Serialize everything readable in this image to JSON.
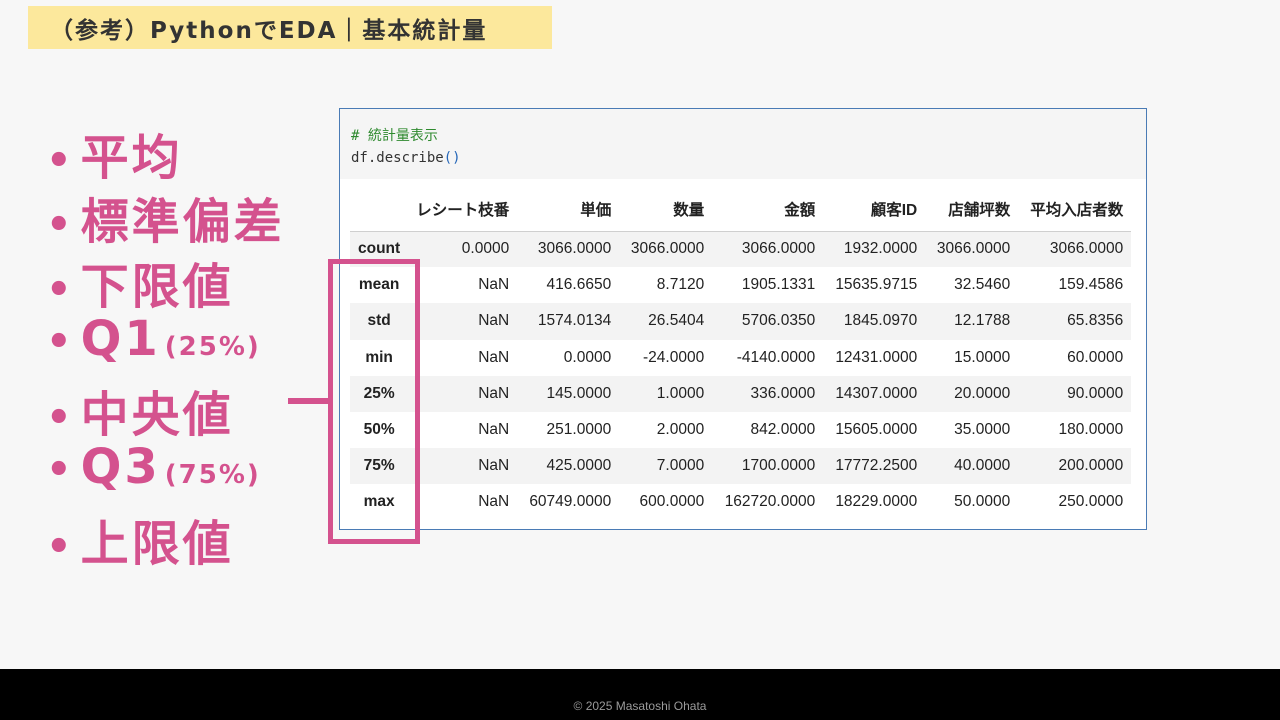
{
  "title": "（参考）PythonでEDA｜基本統計量",
  "bullets": [
    {
      "bullet": "•",
      "text": "平均",
      "sub": ""
    },
    {
      "bullet": "•",
      "text": "標準偏差",
      "sub": ""
    },
    {
      "bullet": "•",
      "text": "下限値",
      "sub": ""
    },
    {
      "bullet": "•",
      "text": "Q1",
      "sub": "(25%)"
    },
    {
      "bullet": "•",
      "text": "中央値",
      "sub": ""
    },
    {
      "bullet": "•",
      "text": "Q3",
      "sub": "(75%)"
    },
    {
      "bullet": "•",
      "text": "上限値",
      "sub": ""
    }
  ],
  "code": {
    "comment": "# 統計量表示",
    "line_prefix": "df.describe",
    "line_parens": "()"
  },
  "table": {
    "headers": [
      "",
      "レシート枝番",
      "単価",
      "数量",
      "金額",
      "顧客ID",
      "店舗坪数",
      "平均入店者数"
    ],
    "rows": [
      {
        "label": "count",
        "cells": [
          "0.0000",
          "3066.0000",
          "3066.0000",
          "3066.0000",
          "1932.0000",
          "3066.0000",
          "3066.0000"
        ]
      },
      {
        "label": "mean",
        "cells": [
          "NaN",
          "416.6650",
          "8.7120",
          "1905.1331",
          "15635.9715",
          "32.5460",
          "159.4586"
        ]
      },
      {
        "label": "std",
        "cells": [
          "NaN",
          "1574.0134",
          "26.5404",
          "5706.0350",
          "1845.0970",
          "12.1788",
          "65.8356"
        ]
      },
      {
        "label": "min",
        "cells": [
          "NaN",
          "0.0000",
          "-24.0000",
          "-4140.0000",
          "12431.0000",
          "15.0000",
          "60.0000"
        ]
      },
      {
        "label": "25%",
        "cells": [
          "NaN",
          "145.0000",
          "1.0000",
          "336.0000",
          "14307.0000",
          "20.0000",
          "90.0000"
        ]
      },
      {
        "label": "50%",
        "cells": [
          "NaN",
          "251.0000",
          "2.0000",
          "842.0000",
          "15605.0000",
          "35.0000",
          "180.0000"
        ]
      },
      {
        "label": "75%",
        "cells": [
          "NaN",
          "425.0000",
          "7.0000",
          "1700.0000",
          "17772.2500",
          "40.0000",
          "200.0000"
        ]
      },
      {
        "label": "max",
        "cells": [
          "NaN",
          "60749.0000",
          "600.0000",
          "162720.0000",
          "18229.0000",
          "50.0000",
          "250.0000"
        ]
      }
    ]
  },
  "footer": "© 2025 Masatoshi Ohata",
  "colors": {
    "accent": "#d4528e",
    "title_bg": "#fce89c",
    "cell_border": "#4a7bb5"
  }
}
